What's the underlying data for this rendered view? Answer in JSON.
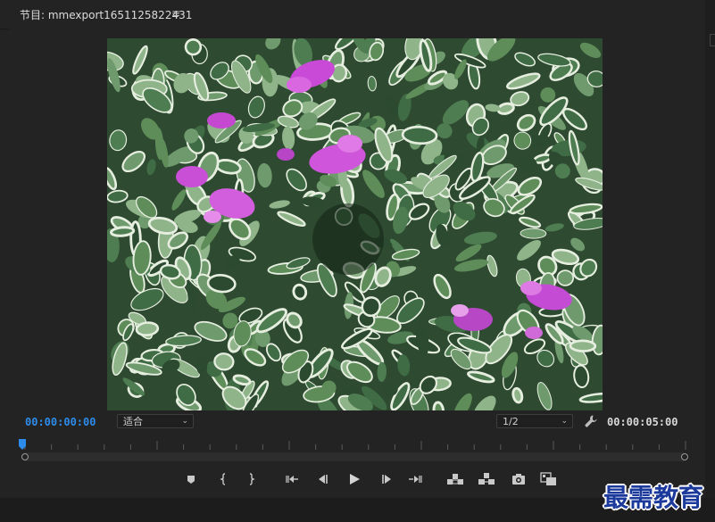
{
  "panel": {
    "title": "节目: mmexport1651125822431",
    "menu_glyph": "≡"
  },
  "timecode": {
    "current": "00:00:00:00",
    "duration": "00:00:05:00",
    "current_color": "#2d8ceb"
  },
  "zoom": {
    "selected": "适合"
  },
  "resolution": {
    "selected": "1/2"
  },
  "controls": [
    {
      "name": "add-marker-button",
      "icon": "marker-icon"
    },
    {
      "name": "mark-in-button",
      "icon": "mark-in-icon"
    },
    {
      "name": "mark-out-button",
      "icon": "mark-out-icon"
    },
    {
      "name": "go-to-in-button",
      "icon": "go-to-in-icon"
    },
    {
      "name": "step-back-button",
      "icon": "step-back-icon"
    },
    {
      "name": "play-button",
      "icon": "play-icon"
    },
    {
      "name": "step-forward-button",
      "icon": "step-forward-icon"
    },
    {
      "name": "go-to-out-button",
      "icon": "go-to-out-icon"
    },
    {
      "name": "lift-button",
      "icon": "lift-icon"
    },
    {
      "name": "extract-button",
      "icon": "extract-icon"
    },
    {
      "name": "export-frame-button",
      "icon": "camera-icon"
    },
    {
      "name": "comparison-view-button",
      "icon": "comparison-icon"
    }
  ],
  "watermark": "最需教育"
}
